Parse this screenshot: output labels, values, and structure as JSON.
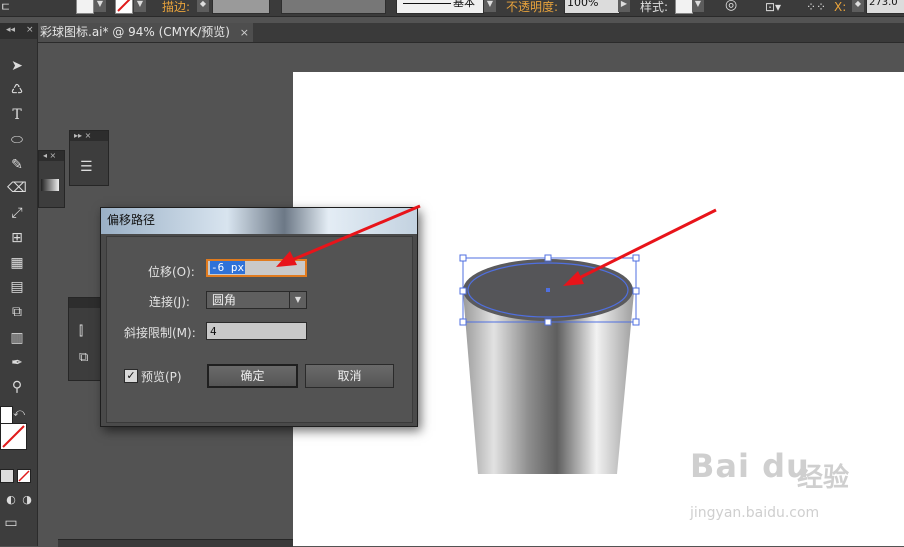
{
  "control_bar": {
    "stroke_label": "描边:",
    "stroke_style": "基本",
    "opacity_label": "不透明度:",
    "opacity_value": "100%",
    "style_label": "样式:",
    "x_label": "X:",
    "x_value": "273.0"
  },
  "document_tab": {
    "title": "彩球图标.ai* @ 94% (CMYK/预览)",
    "close": "×"
  },
  "dialog": {
    "title": "偏移路径",
    "offset_label": "位移(O):",
    "offset_value": "-6 px",
    "join_label": "连接(J):",
    "join_value": "圆角",
    "miter_label": "斜接限制(M):",
    "miter_value": "4",
    "preview_label": "预览(P)",
    "preview_checked": true,
    "ok_label": "确定",
    "cancel_label": "取消"
  },
  "watermark": {
    "logo": "Bai du",
    "cn": "经验",
    "url": "jingyan.baidu.com"
  },
  "colors": {
    "arrow": "#e8141a",
    "selection": "#4f6fe0",
    "ellipse_fill": "#555558",
    "offset_field_border": "#e07b1f"
  }
}
